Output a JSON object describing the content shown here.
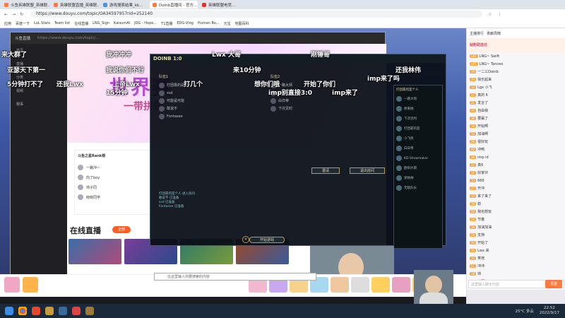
{
  "browser": {
    "tabs": [
      "斗鱼英雄联盟_英雄联...",
      "英雄联盟直播_英雄联...",
      "游戏搜索结果_kk...",
      "Doinb直播间 - 官方...",
      "英雄联盟电竞..."
    ],
    "url": "https://www.douyu.com/topic/OA34597957rid=252140",
    "bookmarks": [
      "应用",
      "百度一下",
      "LoL Stats",
      "Team list",
      "在线直播",
      "LNG_Sign",
      "KaisumAI",
      "JDG - Hope...",
      "T1直播",
      "EDG-Vlog",
      "Human Bo...",
      "元宝",
      "地图百科"
    ]
  },
  "inner": {
    "title": "斗鱼直播",
    "url": "https://www.douyu.com/topic/...",
    "nav": [
      "首页",
      "直播",
      "分类",
      "视频",
      "赛事"
    ],
    "hero_title": "世界赛",
    "hero_sub": "一带拼做",
    "rank_title": "斗鱼之星Rank榜",
    "rank": [
      "一路冲~",
      "向了boy",
      "帅子同",
      "晓晓同学"
    ],
    "live_label": "在线直播",
    "live_btn": "全部"
  },
  "client": {
    "title": "DOINB 1:0",
    "team1": "队伍1",
    "team2": "队伍2",
    "players1": [
      "打团靠的是个人",
      "ssd",
      "可能是可能",
      "敢说不",
      "Fontasee"
    ],
    "players2": [
      "一路大师",
      "原来她",
      "白日帝",
      "下次见时"
    ],
    "ready": "开始游戏",
    "btn1": "邀请",
    "btn2": "退出房间",
    "chat": [
      "打团靠的是个人 进入房间",
      "敢说不 已准备",
      "ssd 已准备",
      "Fontasee 已准备"
    ]
  },
  "friends": {
    "title": "打团靠的是个人",
    "list": [
      "一路大师",
      "原来她",
      "下次见时",
      "打团靠的是",
      "小飞侠",
      "白日帝",
      "KD.Showmaker",
      "欧阳大萌",
      "梁帅帅",
      "无敌队长"
    ]
  },
  "danmu": [
    "来大群了",
    "我冲冲冲",
    "Lwx 大哥",
    "刚锤哥",
    "亚瑟天下第一",
    "我说你们不行",
    "来10分钟",
    "还我林伟",
    "5分钟打不了",
    "还我Lwx",
    "上帝Lwx",
    "打几个",
    "想你们哦",
    "开始了你们",
    "15分钟",
    "imp别直接3:0",
    "imp来了",
    "imp来了吗"
  ],
  "chat": {
    "tabs": [
      "主播排行",
      "贡献周榜"
    ],
    "notice": "钻粉助选日",
    "messages": [
      [
        "LN2",
        "LNG~ Swift"
      ],
      [
        "LN5",
        "LNG~ Tanceo"
      ],
      [
        "29",
        "一二三Doinb"
      ],
      [
        "33",
        "快乐起来"
      ],
      [
        "14",
        "Lgx 小飞"
      ],
      [
        "17",
        "真的 6"
      ],
      [
        "21",
        "发言了"
      ],
      [
        "25",
        "自由我"
      ],
      [
        "36",
        "要赢了"
      ],
      [
        "19",
        "开始啊"
      ],
      [
        "12",
        "加油啊"
      ],
      [
        "28",
        "很好玩"
      ],
      [
        "40",
        "冲鸭"
      ],
      [
        "16",
        "imp id"
      ],
      [
        "22",
        "真6"
      ],
      [
        "31",
        "好家伙"
      ],
      [
        "15",
        "666"
      ],
      [
        "27",
        "开冲"
      ],
      [
        "33",
        "来了来了"
      ],
      [
        "18",
        "稳"
      ],
      [
        "20",
        "我也想玩"
      ],
      [
        "24",
        "节奏"
      ],
      [
        "30",
        "加油加油"
      ],
      [
        "26",
        "支持"
      ],
      [
        "29",
        "开始了"
      ],
      [
        "35",
        "Lwx 来"
      ],
      [
        "14",
        "笑死"
      ],
      [
        "21",
        "冲冲"
      ],
      [
        "38",
        "帅"
      ],
      [
        "23",
        "好耶"
      ]
    ],
    "input_placeholder": "这里输入聊天内容",
    "send": "发送"
  },
  "taskbar": {
    "search": "在这里输入你要搜索的内容",
    "weather": "25°C 多云",
    "time": "22:52",
    "date": "2022/9/17"
  },
  "colors": {
    "accent": "#ff7a3c",
    "lol_gold": "#c9b88a",
    "hero": "#b54ad4"
  }
}
